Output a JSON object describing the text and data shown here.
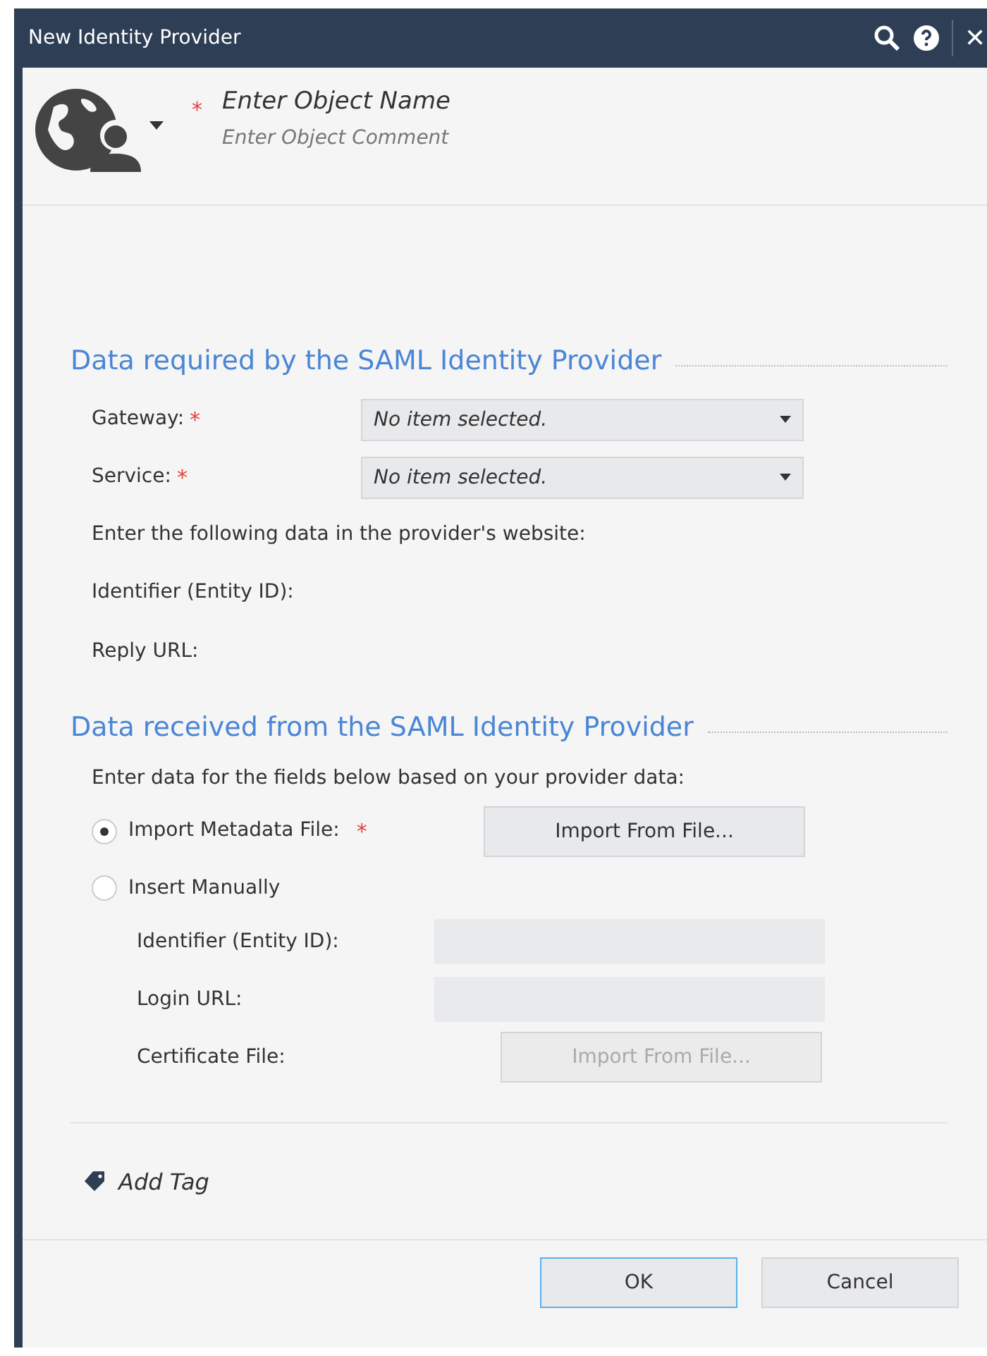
{
  "window": {
    "title": "New Identity Provider",
    "close_glyph": "✕"
  },
  "header": {
    "required_mark": "*",
    "name_placeholder": "Enter Object Name",
    "comment_placeholder": "Enter Object Comment"
  },
  "section_required": {
    "heading": "Data required by the SAML Identity Provider",
    "selects": [
      {
        "label": "Gateway:",
        "required_mark": "*",
        "value": "No item selected."
      },
      {
        "label": "Service:",
        "required_mark": "*",
        "value": "No item selected."
      }
    ],
    "notes": [
      "Enter the following data in the provider's website:",
      "Identifier (Entity ID):",
      "Reply URL:"
    ]
  },
  "section_received": {
    "heading": "Data received from the SAML Identity Provider",
    "intro": "Enter data for the fields below based on your provider data:",
    "options": [
      {
        "label": "Import Metadata File:",
        "required_mark": "*",
        "selected": true,
        "button": "Import From File..."
      },
      {
        "label": "Insert Manually",
        "selected": false
      }
    ],
    "manual_fields": [
      {
        "kind": "input",
        "label": "Identifier (Entity ID):",
        "disabled": true
      },
      {
        "kind": "input",
        "label": "Login URL:",
        "disabled": true
      },
      {
        "kind": "button",
        "label": "Certificate File:",
        "button": "Import From File...",
        "disabled": true
      }
    ]
  },
  "add_tag": "Add Tag",
  "buttons": [
    {
      "label": "OK",
      "default": true
    },
    {
      "label": "Cancel",
      "default": false
    }
  ]
}
